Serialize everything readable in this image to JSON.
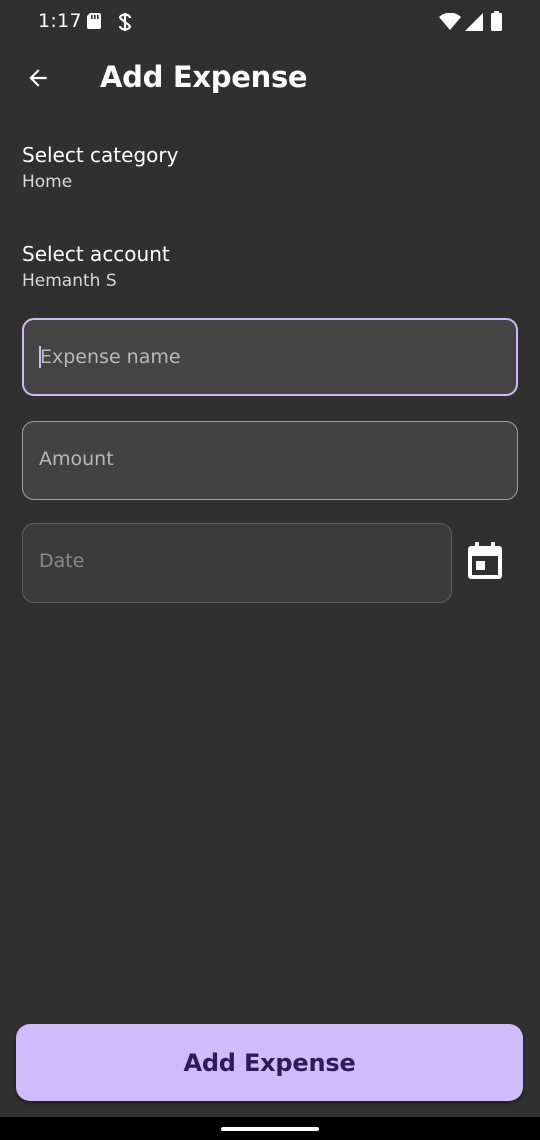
{
  "status_bar": {
    "time": "1:17",
    "icons": [
      "sd-card-icon",
      "vpn-key-icon",
      "wifi-icon",
      "signal-icon",
      "battery-icon"
    ]
  },
  "app_bar": {
    "back_icon": "arrow-back-icon",
    "title": "Add Expense"
  },
  "category": {
    "label": "Select category",
    "value": "Home"
  },
  "account": {
    "label": "Select account",
    "value": "Hemanth S"
  },
  "form": {
    "expense_name_placeholder": "Expense name",
    "amount_placeholder": "Amount",
    "date_placeholder": "Date",
    "calendar_icon": "calendar-icon"
  },
  "submit": {
    "label": "Add Expense"
  },
  "colors": {
    "background": "#303030",
    "accent": "#d0bcfa",
    "focused_outline": "#cbbcf2",
    "button_text": "#2e1a5e"
  }
}
